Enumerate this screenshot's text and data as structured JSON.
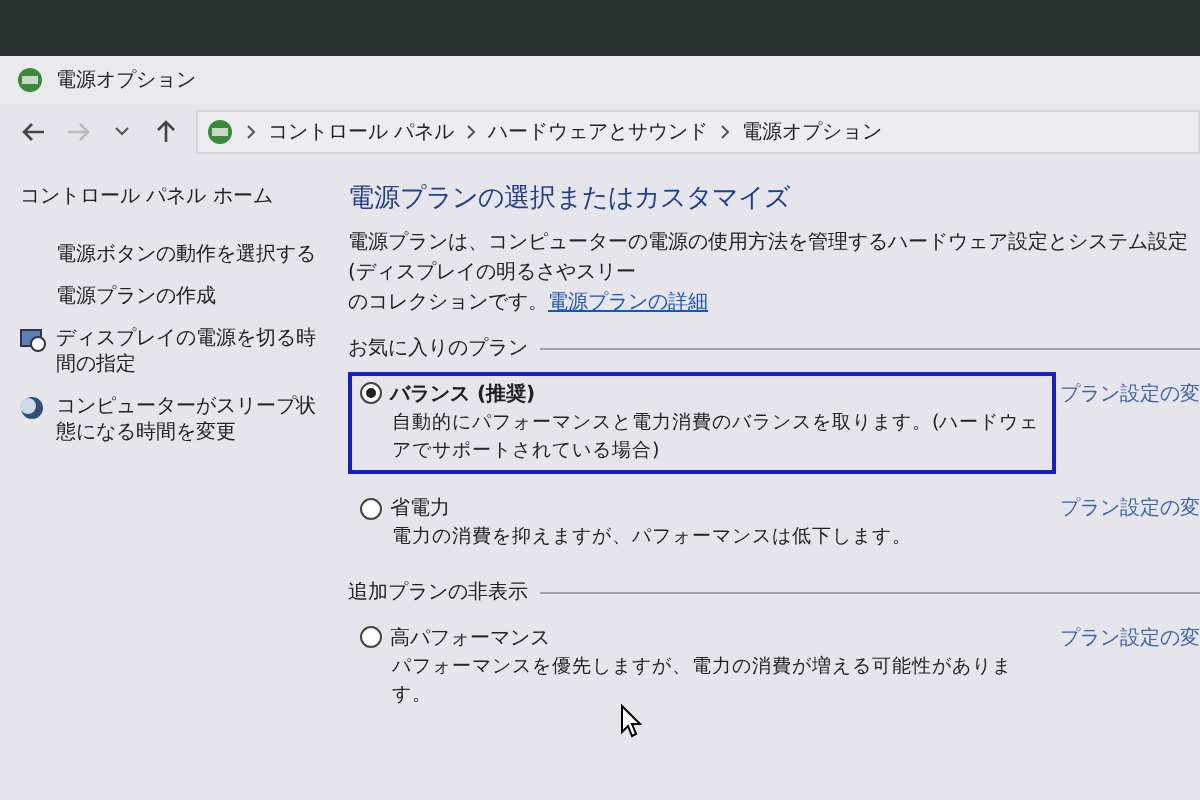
{
  "window": {
    "title": "電源オプション"
  },
  "breadcrumb": [
    "コントロール パネル",
    "ハードウェアとサウンド",
    "電源オプション"
  ],
  "sidebar": {
    "home": "コントロール パネル ホーム",
    "items": [
      {
        "text": "電源ボタンの動作を選択する",
        "kind": "plain"
      },
      {
        "text": "電源プランの作成",
        "kind": "plain"
      },
      {
        "text": "ディスプレイの電源を切る時間の指定",
        "kind": "display"
      },
      {
        "text": "コンピューターがスリープ状態になる時間を変更",
        "kind": "sleep"
      }
    ]
  },
  "main": {
    "heading": "電源プランの選択またはカスタマイズ",
    "description": "電源プランは、コンピューターの電源の使用方法を管理するハードウェア設定とシステム設定 (ディスプレイの明るさやスリー",
    "description_2": "のコレクションです。",
    "link": "電源プランの詳細",
    "sections": [
      {
        "label": "お気に入りのプラン",
        "plans": [
          {
            "name": "バランス (推奨)",
            "description": "自動的にパフォーマンスと電力消費のバランスを取ります。(ハードウェアでサポートされている場合)",
            "selected": true,
            "link": "プラン設定の変"
          },
          {
            "name": "省電力",
            "description": "電力の消費を抑えますが、パフォーマンスは低下します。",
            "selected": false,
            "link": "プラン設定の変"
          }
        ]
      },
      {
        "label": "追加プランの非表示",
        "plans": [
          {
            "name": "高パフォーマンス",
            "description": "パフォーマンスを優先しますが、電力の消費が増える可能性があります。",
            "selected": false,
            "link": "プラン設定の変"
          }
        ]
      }
    ]
  }
}
